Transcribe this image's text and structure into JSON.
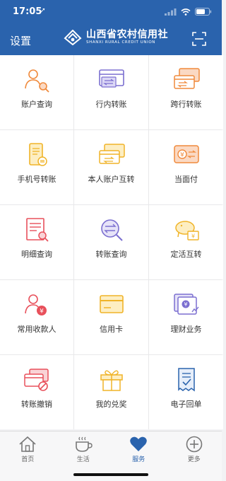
{
  "status": {
    "time": "17:05",
    "location_glyph": "➚"
  },
  "header": {
    "settings_label": "设置",
    "brand_cn": "山西省农村信用社",
    "brand_en": "SHANXI RURAL CREDIT UNION",
    "scan_icon": "scan-icon"
  },
  "services": [
    {
      "label": "账户查询",
      "icon": "account-query-icon"
    },
    {
      "label": "行内转账",
      "icon": "intrabank-transfer-icon"
    },
    {
      "label": "跨行转账",
      "icon": "interbank-transfer-icon"
    },
    {
      "label": "手机号转账",
      "icon": "phone-transfer-icon"
    },
    {
      "label": "本人账户互转",
      "icon": "own-account-transfer-icon"
    },
    {
      "label": "当面付",
      "icon": "face-to-face-pay-icon"
    },
    {
      "label": "明细查询",
      "icon": "detail-query-icon"
    },
    {
      "label": "转账查询",
      "icon": "transfer-query-icon"
    },
    {
      "label": "定活互转",
      "icon": "fixed-current-transfer-icon"
    },
    {
      "label": "常用收款人",
      "icon": "frequent-payee-icon"
    },
    {
      "label": "信用卡",
      "icon": "credit-card-icon"
    },
    {
      "label": "理财业务",
      "icon": "wealth-management-icon"
    },
    {
      "label": "转账撤销",
      "icon": "transfer-cancel-icon"
    },
    {
      "label": "我的兑奖",
      "icon": "gift-icon"
    },
    {
      "label": "电子回单",
      "icon": "e-receipt-icon"
    }
  ],
  "tabs": [
    {
      "label": "首页",
      "icon": "home-icon",
      "active": false
    },
    {
      "label": "生活",
      "icon": "coffee-cup-icon",
      "active": false
    },
    {
      "label": "服务",
      "icon": "heart-icon",
      "active": true
    },
    {
      "label": "更多",
      "icon": "plus-circle-icon",
      "active": false
    }
  ],
  "colors": {
    "brand_blue": "#2a63ad",
    "icon_orange": "#f08a3c",
    "icon_purple": "#7b6fd0",
    "icon_yellow": "#f0b429",
    "icon_red": "#e8505b"
  }
}
